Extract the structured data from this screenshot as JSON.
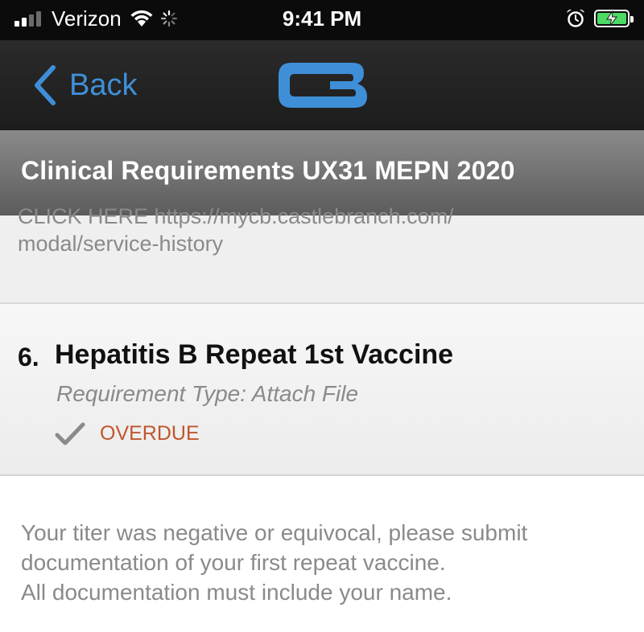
{
  "status_bar": {
    "carrier": "Verizon",
    "time": "9:41 PM",
    "battery_color": "#4cd964"
  },
  "nav": {
    "back_label": "Back",
    "logo_icon": "cb-logo-icon",
    "accent_color": "#3f8fd8"
  },
  "page": {
    "title": "Clinical Requirements UX31 MEPN 2020"
  },
  "previous_item": {
    "clipped_text": "CLICK HERE https://mycb.castlebranch.com/",
    "link_text": "modal/service-history"
  },
  "requirement": {
    "number": "6.",
    "title": "Hepatitis B Repeat 1st Vaccine",
    "type": "Requirement Type: Attach File",
    "status": "OVERDUE",
    "status_color": "#c0562d"
  },
  "description": {
    "lines": [
      "Your titer was negative or equivocal, please submit",
      "documentation of your first repeat vaccine.",
      "All documentation must include your name."
    ]
  }
}
